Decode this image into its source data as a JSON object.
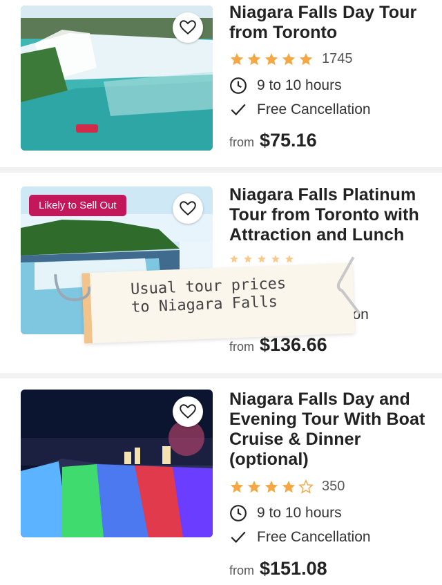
{
  "tours": [
    {
      "title": "Niagara Falls Day Tour from Toronto",
      "rating_stars": 5,
      "reviews": "1745",
      "duration": "9 to 10 hours",
      "cancellation": "Free Cancellation",
      "price_prefix": "from",
      "price": "$75.16"
    },
    {
      "badge": "Likely to Sell Out",
      "title": "Niagara Falls Platinum Tour from Toronto with Attraction and Lunch",
      "partial_text": "tion",
      "price_prefix": "from",
      "price": "$136.66"
    },
    {
      "title": "Niagara Falls Day and Evening Tour With Boat Cruise & Dinner (optional)",
      "rating_stars": 4.5,
      "reviews": "350",
      "duration": "9 to 10 hours",
      "cancellation": "Free Cancellation",
      "price_prefix": "from",
      "price": "$151.08"
    }
  ],
  "note": {
    "text": "Usual tour prices\nto Niagara Falls"
  },
  "colors": {
    "star": "#f4a742",
    "badge": "#c2185b"
  }
}
